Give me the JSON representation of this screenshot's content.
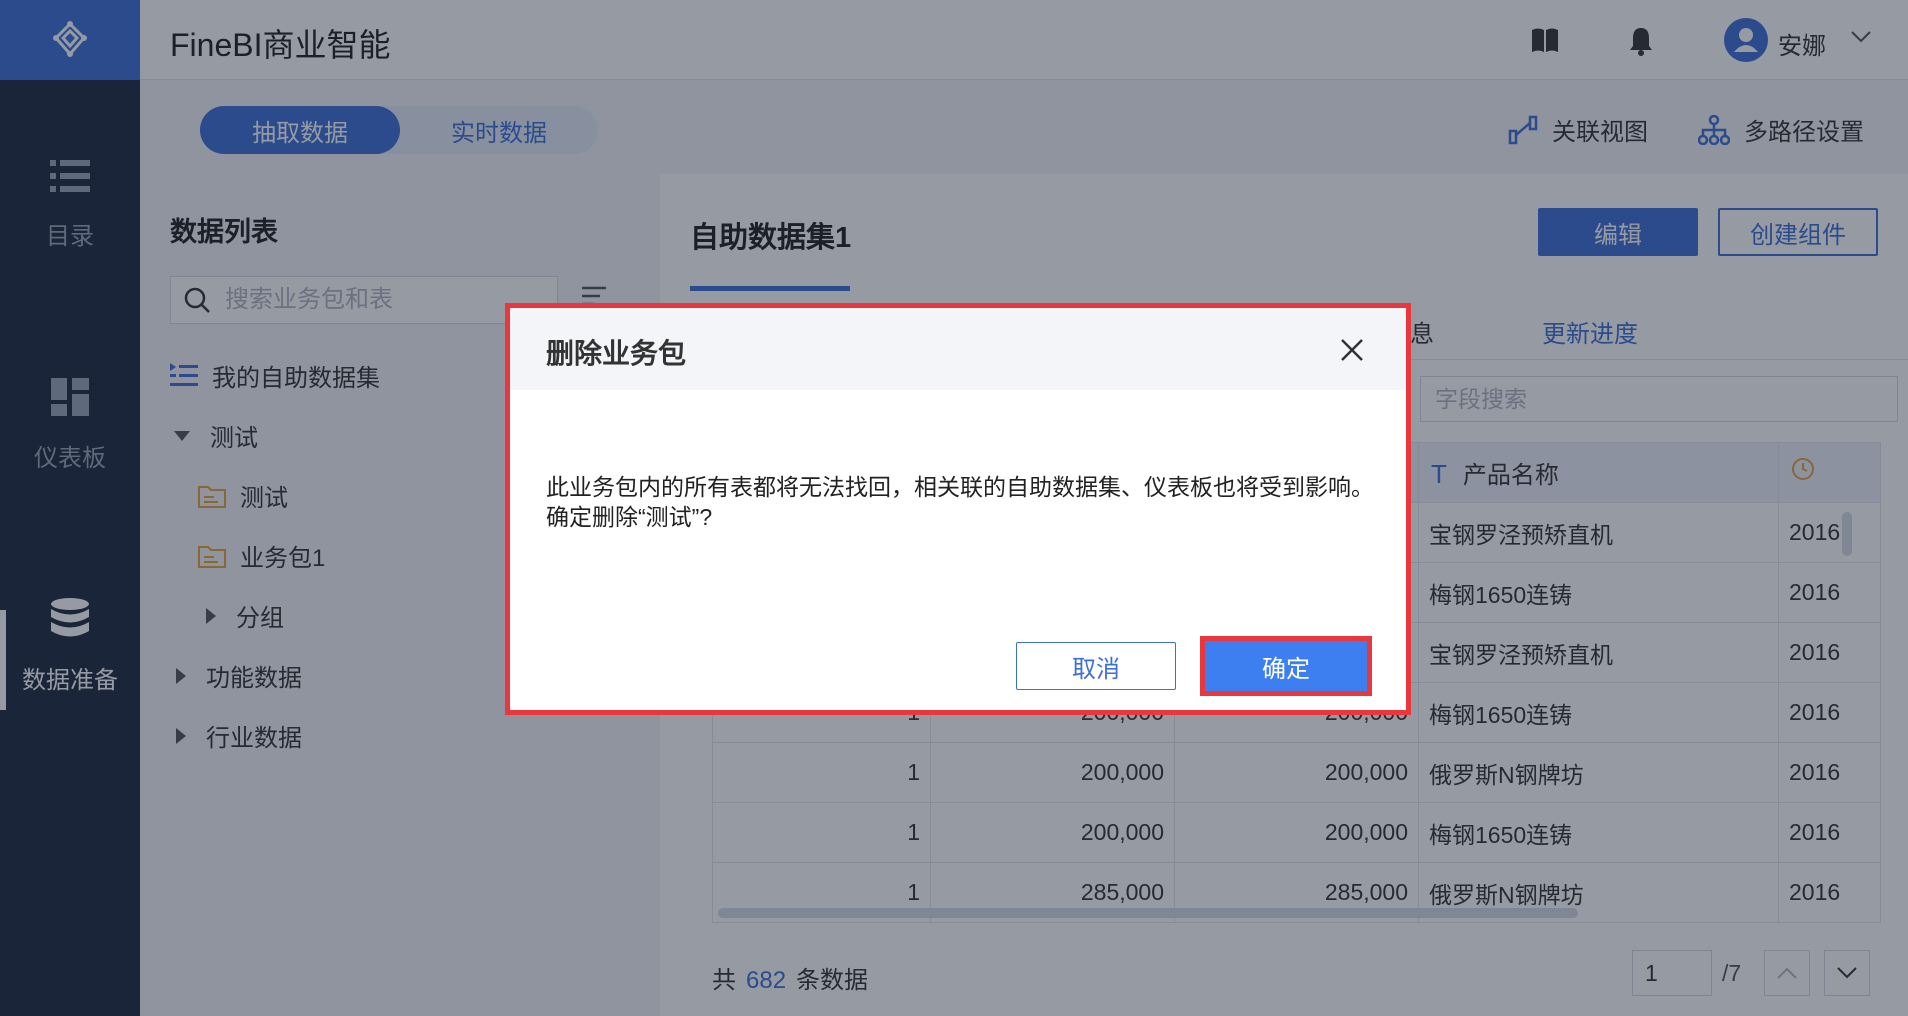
{
  "app": {
    "title": "FineBI商业智能"
  },
  "user": {
    "name": "安娜"
  },
  "nav": {
    "items": [
      {
        "label": "目录"
      },
      {
        "label": "仪表板"
      },
      {
        "label": "数据准备"
      }
    ]
  },
  "toolbar": {
    "toggle": {
      "extract": "抽取数据",
      "realtime": "实时数据"
    },
    "relation_view": "关联视图",
    "multipath": "多路径设置"
  },
  "list_panel": {
    "title": "数据列表",
    "search_placeholder": "搜索业务包和表",
    "tree": [
      {
        "label": "我的自助数据集"
      },
      {
        "label": "测试"
      },
      {
        "label": "测试"
      },
      {
        "label": "业务包1"
      },
      {
        "label": "分组"
      },
      {
        "label": "功能数据"
      },
      {
        "label": "行业数据"
      }
    ]
  },
  "main": {
    "dataset_title": "自助数据集1",
    "edit_button": "编辑",
    "create_button": "创建组件",
    "tab_info_partial": "息",
    "tab_progress": "更新进度",
    "field_search_placeholder": "字段搜索",
    "table": {
      "columns": [
        "",
        "",
        "",
        "产品名称",
        ""
      ],
      "rows": [
        [
          "",
          "",
          "",
          "宝钢罗泾预矫直机",
          "2016"
        ],
        [
          "",
          "",
          "",
          "梅钢1650连铸",
          "2016"
        ],
        [
          "",
          "",
          "",
          "宝钢罗泾预矫直机",
          "2016"
        ],
        [
          "1",
          "200,000",
          "200,000",
          "梅钢1650连铸",
          "2016"
        ],
        [
          "1",
          "200,000",
          "200,000",
          "俄罗斯N钢牌坊",
          "2016"
        ],
        [
          "1",
          "200,000",
          "200,000",
          "梅钢1650连铸",
          "2016"
        ],
        [
          "1",
          "285,000",
          "285,000",
          "俄罗斯N钢牌坊",
          "2016"
        ]
      ]
    },
    "footer": {
      "prefix": "共",
      "count": "682",
      "suffix": "条数据",
      "page_value": "1",
      "page_total": "/7"
    }
  },
  "dialog": {
    "title": "删除业务包",
    "message_line1": "此业务包内的所有表都将无法找回，相关联的自助数据集、仪表板也将受到影响。",
    "message_line2": "确定删除“测试”?",
    "cancel": "取消",
    "confirm": "确定"
  },
  "colors": {
    "brand": "#3d6fd6",
    "nav_bg": "#1e2a3e",
    "highlight_red": "#e8383d"
  }
}
